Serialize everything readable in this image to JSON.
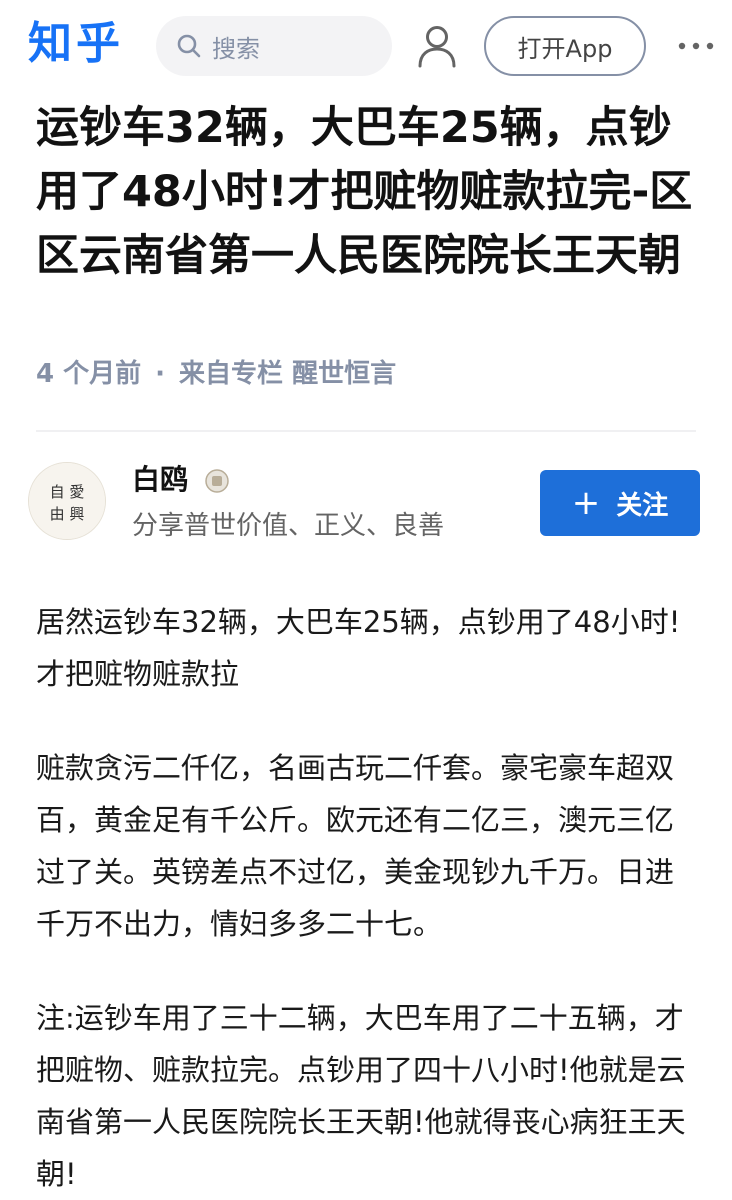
{
  "header": {
    "logo": "知乎",
    "search_placeholder": "搜索",
    "open_app_label": "打开App",
    "icons": [
      "search-icon",
      "user-icon",
      "more-icon"
    ]
  },
  "article": {
    "title": "运钞车32辆，大巴车25辆，点钞用了48小时!才把赃物赃款拉完-区区云南省第一人民医院院长王天朝",
    "meta_time": "4 个月前",
    "meta_separator": "·",
    "meta_source_prefix": "来自专栏",
    "meta_column": "醒世恒言"
  },
  "author": {
    "name": "白鸥",
    "bio": "分享普世价值、正义、良善",
    "follow_plus": "+",
    "follow_label": "关注",
    "avatar_text": "自爱由兴"
  },
  "content": {
    "paragraphs": [
      "居然运钞车32辆，大巴车25辆，点钞用了48小时!才把赃物赃款拉",
      "赃款贪污二仟亿，名画古玩二仟套。豪宅豪车超双百，黄金足有千公斤。欧元还有二亿三，澳元三亿过了关。英镑差点不过亿，美金现钞九千万。日进千万不出力，情妇多多二十七。",
      "注:运钞车用了三十二辆，大巴车用了二十五辆，才把赃物、赃款拉完。点钞用了四十八小时!他就是云南省第一人民医院院长王天朝!他就得丧心病狂王天朝!"
    ]
  },
  "colors": {
    "brand": "#1772f6",
    "follow_button": "#1e6fd9",
    "meta_text": "#8590a6"
  }
}
